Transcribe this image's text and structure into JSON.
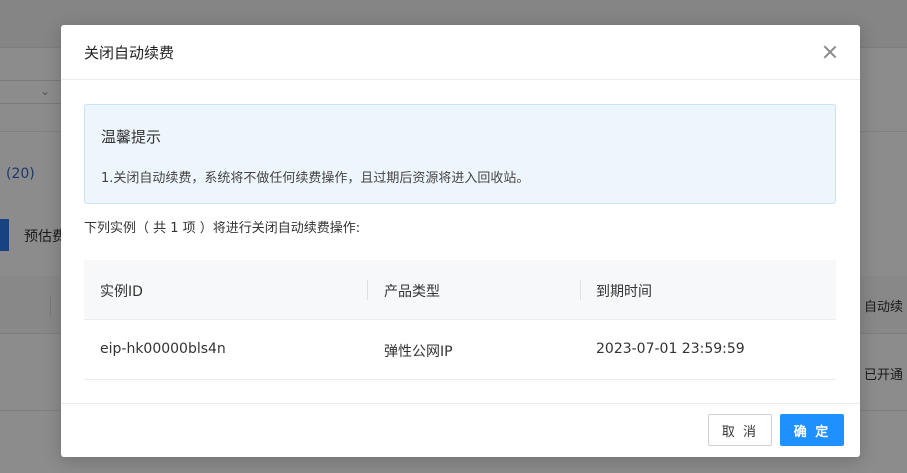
{
  "background": {
    "count_text": "(20)",
    "estimate_button": "预估费",
    "column_auto_renew": "自动续",
    "status_opened": "已开通"
  },
  "modal": {
    "title": "关闭自动续费",
    "notice": {
      "title": "温馨提示",
      "text": "1.关闭自动续费，系统将不做任何续费操作，且过期后资源将进入回收站。"
    },
    "instance_summary": "下列实例（ 共 1 项 ）将进行关闭自动续费操作:",
    "table": {
      "columns": [
        "实例ID",
        "产品类型",
        "到期时间"
      ],
      "rows": [
        [
          "eip-hk00000bls4n",
          "弹性公网IP",
          "2023-07-01 23:59:59"
        ]
      ]
    },
    "footer": {
      "cancel_label": "取 消",
      "confirm_label": "确 定"
    }
  }
}
